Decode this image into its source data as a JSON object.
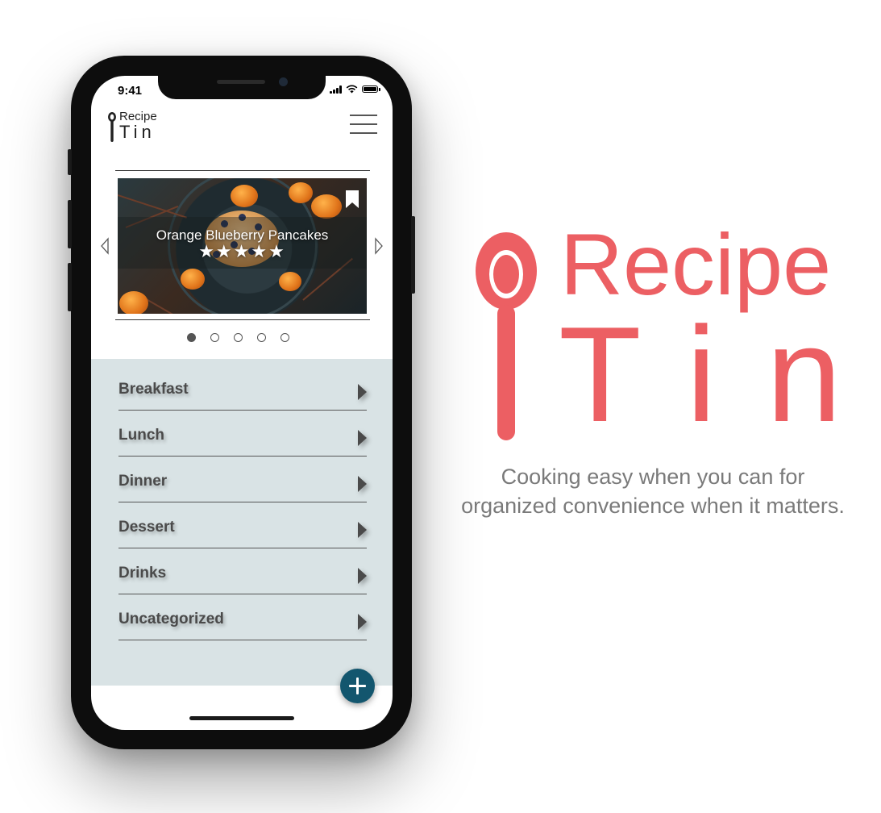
{
  "status_bar": {
    "time": "9:41"
  },
  "app_logo": {
    "word1": "Recipe",
    "word2": "Tin"
  },
  "carousel": {
    "title": "Orange Blueberry Pancakes",
    "rating_stars": "★★★★★",
    "rating": 5,
    "rating_max": 5,
    "active_slide": 1,
    "slide_count": 5
  },
  "categories": [
    {
      "label": "Breakfast"
    },
    {
      "label": "Lunch"
    },
    {
      "label": "Dinner"
    },
    {
      "label": "Dessert"
    },
    {
      "label": "Drinks"
    },
    {
      "label": "Uncategorized"
    }
  ],
  "brand": {
    "word1": "Recipe",
    "word2": "Tin",
    "tagline": "Cooking easy when you can for organized convenience when it matters."
  },
  "colors": {
    "brand_red": "#ec5f63",
    "category_panel": "#d9e3e5",
    "fab": "#13566e",
    "category_text": "#4a4a4a"
  },
  "icons": {
    "menu": "hamburger-icon",
    "bookmark": "bookmark-icon",
    "prev": "chevron-left-icon",
    "next": "chevron-right-icon",
    "add": "plus-icon",
    "spoon": "spoon-icon"
  }
}
